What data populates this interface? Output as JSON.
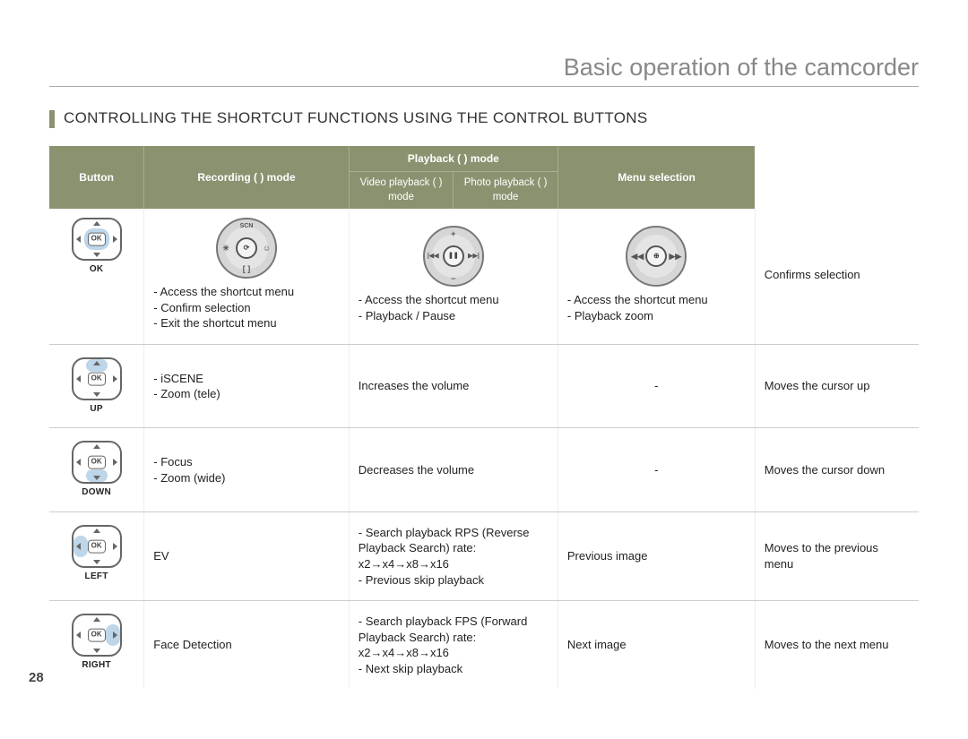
{
  "chapter_title": "Basic operation of the camcorder",
  "section_title": "CONTROLLING THE SHORTCUT FUNCTIONS USING THE CONTROL BUTTONS",
  "page_number": "28",
  "header": {
    "button": "Button",
    "recording": "Recording (        ) mode",
    "playback_group": "Playback (      ) mode",
    "video_playback": "Video playback (      ) mode",
    "photo_playback": "Photo playback (      ) mode",
    "menu_selection": "Menu selection"
  },
  "rows": {
    "ok": {
      "label": "OK",
      "recording": [
        "Access the shortcut menu",
        "Confirm selection",
        "Exit the shortcut menu"
      ],
      "video": [
        "Access the shortcut menu",
        "Playback / Pause"
      ],
      "photo": [
        "Access the shortcut menu",
        "Playback zoom"
      ],
      "menu": "Confirms selection"
    },
    "up": {
      "label": "UP",
      "recording": [
        "iSCENE",
        "Zoom (tele)"
      ],
      "video_text": "Increases the volume",
      "photo_text": "-",
      "menu": "Moves the cursor up"
    },
    "down": {
      "label": "DOWN",
      "recording": [
        "Focus",
        "Zoom (wide)"
      ],
      "video_text": "Decreases the volume",
      "photo_text": "-",
      "menu": "Moves the cursor down"
    },
    "left": {
      "label": "LEFT",
      "recording_text": "EV",
      "video": [
        "Search playback RPS (Reverse Playback Search) rate: x2→x4→x8→x16",
        "Previous skip playback"
      ],
      "photo_text": "Previous image",
      "menu": "Moves to the previous menu"
    },
    "right": {
      "label": "RIGHT",
      "recording_text": "Face Detection",
      "video": [
        "Search playback FPS (Forward Playback Search) rate: x2→x4→x8→x16",
        "Next skip playback"
      ],
      "photo_text": "Next image",
      "menu": "Moves to the next menu"
    }
  },
  "dial_glyphs": {
    "recording_center": "⟳",
    "video_center": "❚❚",
    "video_plus": "+",
    "video_minus": "−",
    "photo_center": "⊕",
    "fast_rev": "◀◀",
    "fast_fwd": "▶▶",
    "skip_rev": "|◀◀",
    "skip_fwd": "▶▶|"
  }
}
